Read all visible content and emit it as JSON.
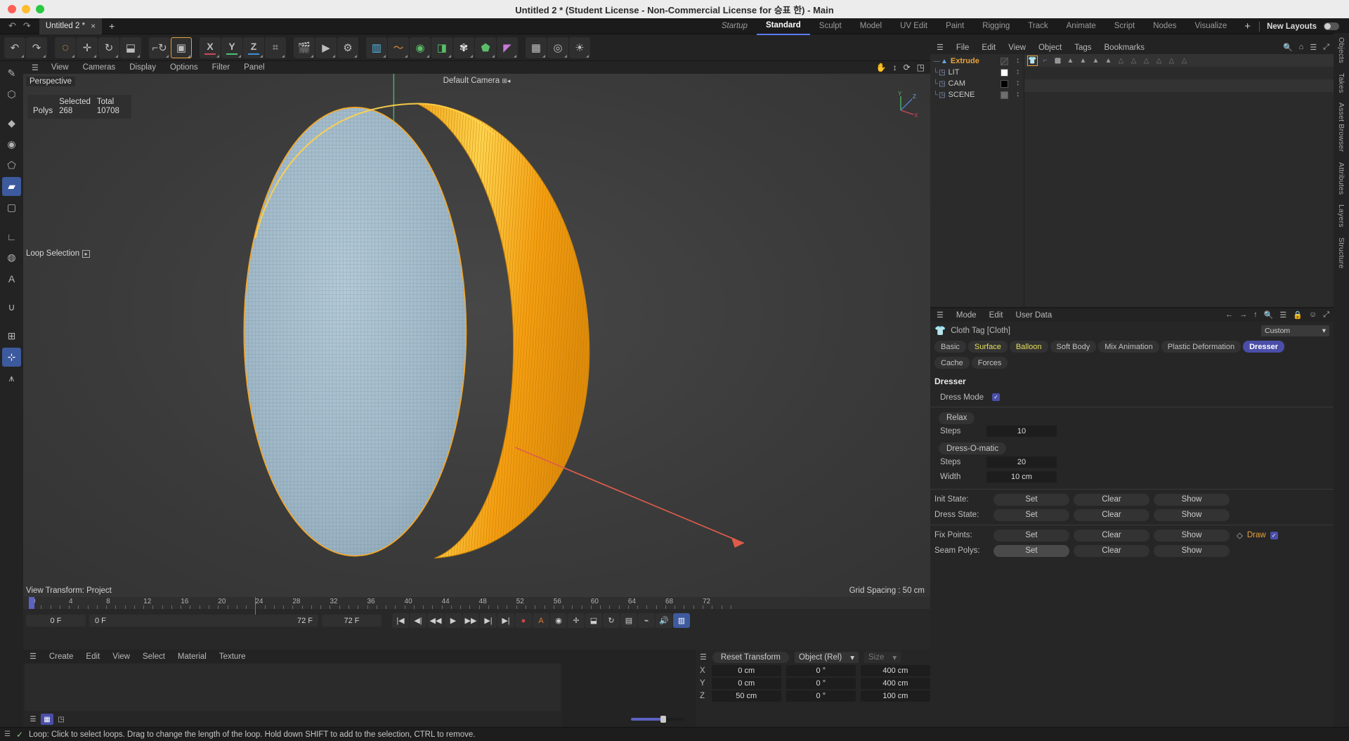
{
  "window": {
    "title": "Untitled 2 * (Student License - Non-Commercial License for 승표 한) - Main"
  },
  "tabstrip": {
    "undo_icon": "↶",
    "redo_icon": "↷",
    "document_tab": "Untitled 2 *",
    "close_icon": "×",
    "add_tab_icon": "+",
    "layouts": [
      {
        "label": "Startup",
        "state": "italic"
      },
      {
        "label": "Standard",
        "state": "active"
      },
      {
        "label": "Sculpt",
        "state": "normal"
      },
      {
        "label": "Model",
        "state": "normal"
      },
      {
        "label": "UV Edit",
        "state": "normal"
      },
      {
        "label": "Paint",
        "state": "normal"
      },
      {
        "label": "Rigging",
        "state": "normal"
      },
      {
        "label": "Track",
        "state": "normal"
      },
      {
        "label": "Animate",
        "state": "normal"
      },
      {
        "label": "Script",
        "state": "normal"
      },
      {
        "label": "Nodes",
        "state": "normal"
      },
      {
        "label": "Visualize",
        "state": "normal"
      }
    ],
    "plus_icon": "+",
    "new_layouts_label": "New Layouts"
  },
  "toolbar": {
    "groups": [
      {
        "buttons": [
          {
            "name": "undo",
            "glyph": "↶"
          },
          {
            "name": "redo",
            "glyph": "↷"
          }
        ]
      },
      {
        "buttons": [
          {
            "name": "live-selection",
            "glyph": "◌",
            "selected_ring": true
          },
          {
            "name": "move",
            "glyph": "✛"
          },
          {
            "name": "rotate",
            "glyph": "↻"
          },
          {
            "name": "scale",
            "glyph": "⬓"
          }
        ]
      },
      {
        "buttons": [
          {
            "name": "world-object-coordinates",
            "glyph": "⌐↻"
          },
          {
            "name": "enable-axis-modification",
            "glyph": "▣",
            "selected": true
          }
        ]
      },
      {
        "buttons": [
          {
            "name": "lock-x-axis",
            "glyph": "X",
            "bar": "#d0485c"
          },
          {
            "name": "lock-y-axis",
            "glyph": "Y",
            "bar": "#4fc174"
          },
          {
            "name": "lock-z-axis",
            "glyph": "Z",
            "bar": "#3f8fd8"
          },
          {
            "name": "world-coordinate-system",
            "glyph": "⌗"
          }
        ]
      },
      {
        "buttons": [
          {
            "name": "render-view",
            "glyph": "🎬"
          },
          {
            "name": "render-to-picture-viewer",
            "glyph": "▶"
          },
          {
            "name": "render-settings",
            "glyph": "⚙"
          }
        ]
      },
      {
        "buttons": [
          {
            "name": "add-cube-object",
            "glyph": "▥",
            "color": "#55b9e8"
          },
          {
            "name": "add-spline",
            "glyph": "〜",
            "color": "#d98b37"
          },
          {
            "name": "add-nurbs-generator",
            "glyph": "◉",
            "color": "#5bbd6a"
          },
          {
            "name": "add-array-object",
            "glyph": "◨",
            "color": "#5bbd6a"
          },
          {
            "name": "add-scene-object",
            "glyph": "✾",
            "color": "#e6e6e6"
          },
          {
            "name": "add-deformer-object",
            "glyph": "⬟",
            "color": "#5bbd6a"
          },
          {
            "name": "add-field-object",
            "glyph": "◤",
            "color": "#c679d8"
          }
        ]
      },
      {
        "buttons": [
          {
            "name": "add-camera",
            "glyph": "▦"
          },
          {
            "name": "add-light",
            "glyph": "◎"
          },
          {
            "name": "add-environment",
            "glyph": "☀"
          }
        ]
      }
    ]
  },
  "left_rail": {
    "tools": [
      {
        "name": "brush-tool",
        "glyph": "✎"
      },
      {
        "name": "make-editable",
        "glyph": "⬡"
      },
      {
        "name": "model-mode",
        "glyph": "◆"
      },
      {
        "name": "object-axis-mode",
        "glyph": "◉"
      },
      {
        "name": "point-mode",
        "glyph": "⬠"
      },
      {
        "name": "polygon-mode",
        "glyph": "▰",
        "active": true
      },
      {
        "name": "edge-mode",
        "glyph": "▢"
      },
      {
        "name": "uv-polygon-mode",
        "glyph": "∟"
      },
      {
        "name": "texture-mode",
        "glyph": "◍"
      },
      {
        "name": "animation-mode",
        "glyph": "A"
      },
      {
        "name": "workplane-mode",
        "glyph": "∪"
      },
      {
        "name": "enable-snap",
        "glyph": "⊞"
      },
      {
        "name": "enable-axis-modify",
        "glyph": "⊹",
        "active": true
      },
      {
        "name": "enable-axis-a",
        "glyph": "⩚"
      }
    ]
  },
  "viewport": {
    "menu": [
      "View",
      "Cameras",
      "Display",
      "Options",
      "Filter",
      "Panel"
    ],
    "perspective_label": "Perspective",
    "camera_label": "Default Camera",
    "stats": {
      "col_selected": "Selected",
      "col_total": "Total",
      "row_label": "Polys",
      "selected": "268",
      "total": "10708"
    },
    "loop_selection_label": "Loop Selection",
    "view_transform": "View Transform: Project",
    "grid_spacing": "Grid Spacing : 50 cm",
    "axis_labels": {
      "x": "X",
      "y": "Y",
      "z": "Z"
    },
    "nav_icons": [
      "pan-icon",
      "dolly-icon",
      "rotate-icon",
      "maximize-icon"
    ]
  },
  "object_manager": {
    "menu": [
      "File",
      "Edit",
      "View",
      "Object",
      "Tags",
      "Bookmarks"
    ],
    "right_icons": [
      "search-icon",
      "home-icon",
      "list-icon",
      "expand-icon"
    ],
    "objects": [
      {
        "name": "Extrude",
        "icon": "generator-icon",
        "selected": true,
        "swatch": "#6e6e6e",
        "swatch_style": "diagonal"
      },
      {
        "name": "LIT",
        "icon": "null-icon",
        "selected": false,
        "swatch": "#ffffff"
      },
      {
        "name": "CAM",
        "icon": "null-icon",
        "selected": false,
        "swatch": "#000000"
      },
      {
        "name": "SCENE",
        "icon": "null-icon",
        "selected": false,
        "swatch": "#6e6e6e"
      }
    ],
    "tags": [
      {
        "name": "cloth-tag",
        "glyph": "👕",
        "selected": true
      },
      {
        "name": "cloth-belt-tag",
        "glyph": "⌐"
      },
      {
        "name": "texture-tag",
        "glyph": "▩"
      },
      {
        "name": "triangle-tag-1",
        "glyph": "▲"
      },
      {
        "name": "triangle-tag-2",
        "glyph": "▲"
      },
      {
        "name": "triangle-tag-3",
        "glyph": "▲"
      },
      {
        "name": "triangle-tag-4",
        "glyph": "▲"
      },
      {
        "name": "triangle-outline-1",
        "glyph": "△"
      },
      {
        "name": "triangle-outline-2",
        "glyph": "△"
      },
      {
        "name": "triangle-outline-3",
        "glyph": "△"
      },
      {
        "name": "triangle-outline-4",
        "glyph": "△"
      },
      {
        "name": "triangle-outline-5",
        "glyph": "△"
      },
      {
        "name": "triangle-outline-6",
        "glyph": "△"
      }
    ]
  },
  "attribute_manager": {
    "menu": [
      "Mode",
      "Edit",
      "User Data"
    ],
    "right_icons": [
      "back-arrow",
      "forward-arrow",
      "up-arrow",
      "search-icon",
      "list-icon",
      "lock-icon",
      "info-icon",
      "expand-icon"
    ],
    "tag_title": "Cloth Tag [Cloth]",
    "preset_value": "Custom",
    "tabs": [
      {
        "label": "Basic",
        "state": "normal"
      },
      {
        "label": "Surface",
        "state": "highlight"
      },
      {
        "label": "Balloon",
        "state": "highlight"
      },
      {
        "label": "Soft Body",
        "state": "normal"
      },
      {
        "label": "Mix Animation",
        "state": "normal"
      },
      {
        "label": "Plastic Deformation",
        "state": "normal"
      },
      {
        "label": "Dresser",
        "state": "selected"
      },
      {
        "label": "Cache",
        "state": "normal"
      },
      {
        "label": "Forces",
        "state": "normal"
      }
    ],
    "section_title": "Dresser",
    "dress_mode": {
      "label": "Dress Mode",
      "checked": true
    },
    "relax": {
      "group_label": "Relax",
      "steps_label": "Steps",
      "steps_value": "10"
    },
    "dress_o_matic": {
      "group_label": "Dress-O-matic",
      "steps_label": "Steps",
      "steps_value": "20",
      "width_label": "Width",
      "width_value": "10 cm"
    },
    "state_rows": [
      {
        "label": "Init State:",
        "set": "Set",
        "clear": "Clear",
        "show": "Show",
        "set_lit": false
      },
      {
        "label": "Dress State:",
        "set": "Set",
        "clear": "Clear",
        "show": "Show",
        "set_lit": false
      },
      {
        "label": "Fix Points:",
        "set": "Set",
        "clear": "Clear",
        "show": "Show",
        "set_lit": false,
        "draw_label": "Draw",
        "draw_checked": true
      },
      {
        "label": "Seam Polys:",
        "set": "Set",
        "clear": "Clear",
        "show": "Show",
        "set_lit": true
      }
    ]
  },
  "vertical_tabs": [
    "Objects",
    "Takes",
    "Asset Browser",
    "Attributes",
    "Layers",
    "Structure"
  ],
  "timeline": {
    "ticks": [
      0,
      4,
      8,
      12,
      16,
      20,
      24,
      28,
      32,
      36,
      40,
      44,
      48,
      52,
      56,
      60,
      64,
      68,
      72
    ],
    "current_frame": "0 F",
    "range_start": "0 F",
    "range_end": "72 F",
    "max_frame": "72 F",
    "playhead_frame": 0,
    "marker_frame": 24,
    "transport": [
      {
        "name": "go-to-start",
        "glyph": "|◀"
      },
      {
        "name": "previous-key",
        "glyph": "◀|"
      },
      {
        "name": "step-back",
        "glyph": "◀◀"
      },
      {
        "name": "play",
        "glyph": "▶"
      },
      {
        "name": "step-forward",
        "glyph": "▶▶"
      },
      {
        "name": "next-key",
        "glyph": "▶|"
      },
      {
        "name": "go-to-end",
        "glyph": "▶|"
      },
      {
        "name": "record-active-objects",
        "glyph": "●",
        "color": "red"
      },
      {
        "name": "autokeying",
        "glyph": "A",
        "color": "orange"
      },
      {
        "name": "keyframe-selection",
        "glyph": "◉"
      },
      {
        "name": "position-key",
        "glyph": "✛"
      },
      {
        "name": "scale-key",
        "glyph": "⬓"
      },
      {
        "name": "rotation-key",
        "glyph": "↻"
      },
      {
        "name": "parameter-key",
        "glyph": "▤"
      },
      {
        "name": "point-level-animation",
        "glyph": "⌁"
      },
      {
        "name": "sound-toggle",
        "glyph": "🔊"
      },
      {
        "name": "level-of-detail",
        "glyph": "▥",
        "color": "blue"
      }
    ]
  },
  "material_manager": {
    "menu": [
      "Create",
      "Edit",
      "View",
      "Select",
      "Material",
      "Texture"
    ],
    "view_modes": [
      {
        "name": "list-view",
        "glyph": "☰",
        "active": false
      },
      {
        "name": "grid-view",
        "glyph": "▦",
        "active": true
      },
      {
        "name": "large-icons-view",
        "glyph": "◳",
        "active": false
      }
    ]
  },
  "coordinate_manager": {
    "reset_label": "Reset Transform",
    "space_dropdown": "Object (Rel)",
    "size_dropdown": "Size",
    "rows": [
      {
        "axis": "X",
        "position": "0 cm",
        "rotation": "0 °",
        "size": "400 cm"
      },
      {
        "axis": "Y",
        "position": "0 cm",
        "rotation": "0 °",
        "size": "400 cm"
      },
      {
        "axis": "Z",
        "position": "50 cm",
        "rotation": "0 °",
        "size": "100 cm"
      }
    ]
  },
  "status_bar": {
    "message": "Loop: Click to select loops. Drag to change the length of the loop. Hold down SHIFT to add to the selection, CTRL to remove."
  },
  "colors": {
    "accent_orange": "#e8a33d",
    "accent_blue": "#4a4ea8",
    "highlight_yellow": "#e6e05a",
    "mesh_selected": "#f5a623",
    "mesh_face": "#9bb8cc"
  }
}
